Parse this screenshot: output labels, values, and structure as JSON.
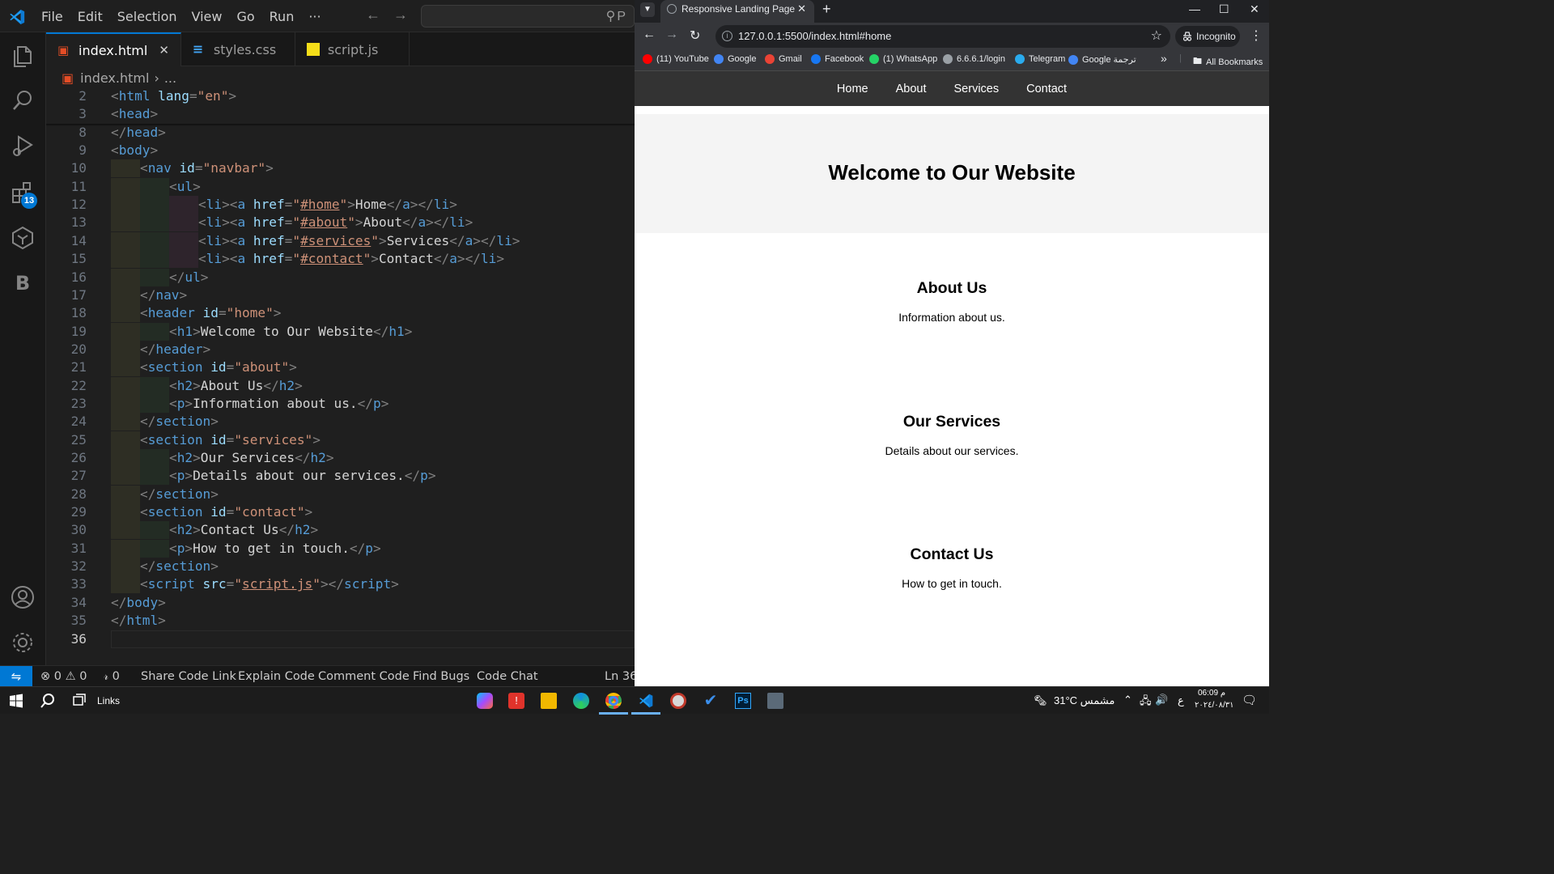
{
  "vscode": {
    "menu": [
      "File",
      "Edit",
      "Selection",
      "View",
      "Go",
      "Run",
      "···"
    ],
    "search_placeholder": "P",
    "tabs": [
      {
        "label": "index.html",
        "icon": "html5-icon",
        "active": true
      },
      {
        "label": "styles.css",
        "icon": "css-icon",
        "active": false
      },
      {
        "label": "script.js",
        "icon": "js-icon",
        "active": false
      }
    ],
    "breadcrumb": {
      "file": "index.html",
      "rest": "..."
    },
    "extensions_badge": "13",
    "current_line": "36",
    "status": {
      "errors": "0",
      "warnings": "0",
      "ports": "0",
      "items": [
        "Share Code Link",
        "Explain Code",
        "Comment Code",
        "Find Bugs",
        "Code Chat"
      ],
      "position": "Ln 36,"
    }
  },
  "code_lines": [
    {
      "n": "2",
      "indent": 0,
      "tokens": [
        [
          "b",
          "<"
        ],
        [
          "tag",
          "html"
        ],
        [
          "txt",
          " "
        ],
        [
          "attr",
          "lang"
        ],
        [
          "b",
          "="
        ],
        [
          "str",
          "\"en\""
        ],
        [
          "b",
          ">"
        ]
      ]
    },
    {
      "n": "3",
      "indent": 0,
      "tokens": [
        [
          "b",
          "<"
        ],
        [
          "tag",
          "head"
        ],
        [
          "b",
          ">"
        ]
      ]
    },
    {
      "n": "8",
      "indent": 0,
      "tokens": [
        [
          "b",
          "</"
        ],
        [
          "tag",
          "head"
        ],
        [
          "b",
          ">"
        ]
      ]
    },
    {
      "n": "9",
      "indent": 0,
      "tokens": [
        [
          "b",
          "<"
        ],
        [
          "tag",
          "body"
        ],
        [
          "b",
          ">"
        ]
      ]
    },
    {
      "n": "10",
      "indent": 1,
      "tokens": [
        [
          "b",
          "<"
        ],
        [
          "tag",
          "nav"
        ],
        [
          "txt",
          " "
        ],
        [
          "attr",
          "id"
        ],
        [
          "b",
          "="
        ],
        [
          "str",
          "\"navbar\""
        ],
        [
          "b",
          ">"
        ]
      ]
    },
    {
      "n": "11",
      "indent": 2,
      "tokens": [
        [
          "b",
          "<"
        ],
        [
          "tag",
          "ul"
        ],
        [
          "b",
          ">"
        ]
      ]
    },
    {
      "n": "12",
      "indent": 3,
      "tokens": [
        [
          "b",
          "<"
        ],
        [
          "tag",
          "li"
        ],
        [
          "b",
          "><"
        ],
        [
          "tag",
          "a"
        ],
        [
          "txt",
          " "
        ],
        [
          "attr",
          "href"
        ],
        [
          "b",
          "="
        ],
        [
          "str",
          "\""
        ],
        [
          "stru",
          "#home"
        ],
        [
          "str",
          "\""
        ],
        [
          "b",
          ">"
        ],
        [
          "txt",
          "Home"
        ],
        [
          "b",
          "</"
        ],
        [
          "tag",
          "a"
        ],
        [
          "b",
          "></"
        ],
        [
          "tag",
          "li"
        ],
        [
          "b",
          ">"
        ]
      ]
    },
    {
      "n": "13",
      "indent": 3,
      "tokens": [
        [
          "b",
          "<"
        ],
        [
          "tag",
          "li"
        ],
        [
          "b",
          "><"
        ],
        [
          "tag",
          "a"
        ],
        [
          "txt",
          " "
        ],
        [
          "attr",
          "href"
        ],
        [
          "b",
          "="
        ],
        [
          "str",
          "\""
        ],
        [
          "stru",
          "#about"
        ],
        [
          "str",
          "\""
        ],
        [
          "b",
          ">"
        ],
        [
          "txt",
          "About"
        ],
        [
          "b",
          "</"
        ],
        [
          "tag",
          "a"
        ],
        [
          "b",
          "></"
        ],
        [
          "tag",
          "li"
        ],
        [
          "b",
          ">"
        ]
      ]
    },
    {
      "n": "14",
      "indent": 3,
      "tokens": [
        [
          "b",
          "<"
        ],
        [
          "tag",
          "li"
        ],
        [
          "b",
          "><"
        ],
        [
          "tag",
          "a"
        ],
        [
          "txt",
          " "
        ],
        [
          "attr",
          "href"
        ],
        [
          "b",
          "="
        ],
        [
          "str",
          "\""
        ],
        [
          "stru",
          "#services"
        ],
        [
          "str",
          "\""
        ],
        [
          "b",
          ">"
        ],
        [
          "txt",
          "Services"
        ],
        [
          "b",
          "</"
        ],
        [
          "tag",
          "a"
        ],
        [
          "b",
          "></"
        ],
        [
          "tag",
          "li"
        ],
        [
          "b",
          ">"
        ]
      ]
    },
    {
      "n": "15",
      "indent": 3,
      "tokens": [
        [
          "b",
          "<"
        ],
        [
          "tag",
          "li"
        ],
        [
          "b",
          "><"
        ],
        [
          "tag",
          "a"
        ],
        [
          "txt",
          " "
        ],
        [
          "attr",
          "href"
        ],
        [
          "b",
          "="
        ],
        [
          "str",
          "\""
        ],
        [
          "stru",
          "#contact"
        ],
        [
          "str",
          "\""
        ],
        [
          "b",
          ">"
        ],
        [
          "txt",
          "Contact"
        ],
        [
          "b",
          "</"
        ],
        [
          "tag",
          "a"
        ],
        [
          "b",
          "></"
        ],
        [
          "tag",
          "li"
        ],
        [
          "b",
          ">"
        ]
      ]
    },
    {
      "n": "16",
      "indent": 2,
      "tokens": [
        [
          "b",
          "</"
        ],
        [
          "tag",
          "ul"
        ],
        [
          "b",
          ">"
        ]
      ]
    },
    {
      "n": "17",
      "indent": 1,
      "tokens": [
        [
          "b",
          "</"
        ],
        [
          "tag",
          "nav"
        ],
        [
          "b",
          ">"
        ]
      ]
    },
    {
      "n": "18",
      "indent": 1,
      "tokens": [
        [
          "b",
          "<"
        ],
        [
          "tag",
          "header"
        ],
        [
          "txt",
          " "
        ],
        [
          "attr",
          "id"
        ],
        [
          "b",
          "="
        ],
        [
          "str",
          "\"home\""
        ],
        [
          "b",
          ">"
        ]
      ]
    },
    {
      "n": "19",
      "indent": 2,
      "tokens": [
        [
          "b",
          "<"
        ],
        [
          "tag",
          "h1"
        ],
        [
          "b",
          ">"
        ],
        [
          "txt",
          "Welcome to Our Website"
        ],
        [
          "b",
          "</"
        ],
        [
          "tag",
          "h1"
        ],
        [
          "b",
          ">"
        ]
      ]
    },
    {
      "n": "20",
      "indent": 1,
      "tokens": [
        [
          "b",
          "</"
        ],
        [
          "tag",
          "header"
        ],
        [
          "b",
          ">"
        ]
      ]
    },
    {
      "n": "21",
      "indent": 1,
      "tokens": [
        [
          "b",
          "<"
        ],
        [
          "tag",
          "section"
        ],
        [
          "txt",
          " "
        ],
        [
          "attr",
          "id"
        ],
        [
          "b",
          "="
        ],
        [
          "str",
          "\"about\""
        ],
        [
          "b",
          ">"
        ]
      ]
    },
    {
      "n": "22",
      "indent": 2,
      "tokens": [
        [
          "b",
          "<"
        ],
        [
          "tag",
          "h2"
        ],
        [
          "b",
          ">"
        ],
        [
          "txt",
          "About Us"
        ],
        [
          "b",
          "</"
        ],
        [
          "tag",
          "h2"
        ],
        [
          "b",
          ">"
        ]
      ]
    },
    {
      "n": "23",
      "indent": 2,
      "tokens": [
        [
          "b",
          "<"
        ],
        [
          "tag",
          "p"
        ],
        [
          "b",
          ">"
        ],
        [
          "txt",
          "Information about us."
        ],
        [
          "b",
          "</"
        ],
        [
          "tag",
          "p"
        ],
        [
          "b",
          ">"
        ]
      ]
    },
    {
      "n": "24",
      "indent": 1,
      "tokens": [
        [
          "b",
          "</"
        ],
        [
          "tag",
          "section"
        ],
        [
          "b",
          ">"
        ]
      ]
    },
    {
      "n": "25",
      "indent": 1,
      "tokens": [
        [
          "b",
          "<"
        ],
        [
          "tag",
          "section"
        ],
        [
          "txt",
          " "
        ],
        [
          "attr",
          "id"
        ],
        [
          "b",
          "="
        ],
        [
          "str",
          "\"services\""
        ],
        [
          "b",
          ">"
        ]
      ]
    },
    {
      "n": "26",
      "indent": 2,
      "tokens": [
        [
          "b",
          "<"
        ],
        [
          "tag",
          "h2"
        ],
        [
          "b",
          ">"
        ],
        [
          "txt",
          "Our Services"
        ],
        [
          "b",
          "</"
        ],
        [
          "tag",
          "h2"
        ],
        [
          "b",
          ">"
        ]
      ]
    },
    {
      "n": "27",
      "indent": 2,
      "tokens": [
        [
          "b",
          "<"
        ],
        [
          "tag",
          "p"
        ],
        [
          "b",
          ">"
        ],
        [
          "txt",
          "Details about our services."
        ],
        [
          "b",
          "</"
        ],
        [
          "tag",
          "p"
        ],
        [
          "b",
          ">"
        ]
      ]
    },
    {
      "n": "28",
      "indent": 1,
      "tokens": [
        [
          "b",
          "</"
        ],
        [
          "tag",
          "section"
        ],
        [
          "b",
          ">"
        ]
      ]
    },
    {
      "n": "29",
      "indent": 1,
      "tokens": [
        [
          "b",
          "<"
        ],
        [
          "tag",
          "section"
        ],
        [
          "txt",
          " "
        ],
        [
          "attr",
          "id"
        ],
        [
          "b",
          "="
        ],
        [
          "str",
          "\"contact\""
        ],
        [
          "b",
          ">"
        ]
      ]
    },
    {
      "n": "30",
      "indent": 2,
      "tokens": [
        [
          "b",
          "<"
        ],
        [
          "tag",
          "h2"
        ],
        [
          "b",
          ">"
        ],
        [
          "txt",
          "Contact Us"
        ],
        [
          "b",
          "</"
        ],
        [
          "tag",
          "h2"
        ],
        [
          "b",
          ">"
        ]
      ]
    },
    {
      "n": "31",
      "indent": 2,
      "tokens": [
        [
          "b",
          "<"
        ],
        [
          "tag",
          "p"
        ],
        [
          "b",
          ">"
        ],
        [
          "txt",
          "How to get in touch."
        ],
        [
          "b",
          "</"
        ],
        [
          "tag",
          "p"
        ],
        [
          "b",
          ">"
        ]
      ]
    },
    {
      "n": "32",
      "indent": 1,
      "tokens": [
        [
          "b",
          "</"
        ],
        [
          "tag",
          "section"
        ],
        [
          "b",
          ">"
        ]
      ]
    },
    {
      "n": "33",
      "indent": 1,
      "tokens": [
        [
          "b",
          "<"
        ],
        [
          "tag",
          "script"
        ],
        [
          "txt",
          " "
        ],
        [
          "attr",
          "src"
        ],
        [
          "b",
          "="
        ],
        [
          "str",
          "\""
        ],
        [
          "stru",
          "script.js"
        ],
        [
          "str",
          "\""
        ],
        [
          "b",
          "></"
        ],
        [
          "tag",
          "script"
        ],
        [
          "b",
          ">"
        ]
      ]
    },
    {
      "n": "34",
      "indent": 0,
      "tokens": [
        [
          "b",
          "</"
        ],
        [
          "tag",
          "body"
        ],
        [
          "b",
          ">"
        ]
      ]
    },
    {
      "n": "35",
      "indent": 0,
      "tokens": [
        [
          "b",
          "</"
        ],
        [
          "tag",
          "html"
        ],
        [
          "b",
          ">"
        ]
      ]
    },
    {
      "n": "36",
      "indent": 0,
      "tokens": []
    }
  ],
  "browser": {
    "tab_title": "Responsive Landing Page",
    "url": "127.0.0.1:5500/index.html#home",
    "incognito_label": "Incognito",
    "bookmarks": [
      {
        "label": "(11) YouTube",
        "color": "#ff0000"
      },
      {
        "label": "Google",
        "color": "#4285f4"
      },
      {
        "label": "Gmail",
        "color": "#ea4335"
      },
      {
        "label": "Facebook",
        "color": "#1877f2"
      },
      {
        "label": "(1) WhatsApp",
        "color": "#25d366"
      },
      {
        "label": "6.6.6.1/login",
        "color": "#9aa0a6"
      },
      {
        "label": "Telegram",
        "color": "#2aabee"
      },
      {
        "label": "Google ترجمة",
        "color": "#4285f4"
      }
    ],
    "bookmarks_more": "»",
    "all_bookmarks": "All Bookmarks"
  },
  "site": {
    "nav": [
      "Home",
      "About",
      "Services",
      "Contact"
    ],
    "header_title": "Welcome to Our Website",
    "sections": [
      {
        "title": "About Us",
        "text": "Information about us."
      },
      {
        "title": "Our Services",
        "text": "Details about our services."
      },
      {
        "title": "Contact Us",
        "text": "How to get in touch."
      }
    ]
  },
  "taskbar": {
    "search_label": "Links",
    "weather": "31°C مشمس",
    "lang": "ع",
    "time": "06:09 م",
    "date": "٢٠٢٤/٠٨/٣١"
  },
  "colors": {
    "accent": "#0078d4",
    "nav_bg": "#333333",
    "header_bg": "#f4f4f4"
  }
}
